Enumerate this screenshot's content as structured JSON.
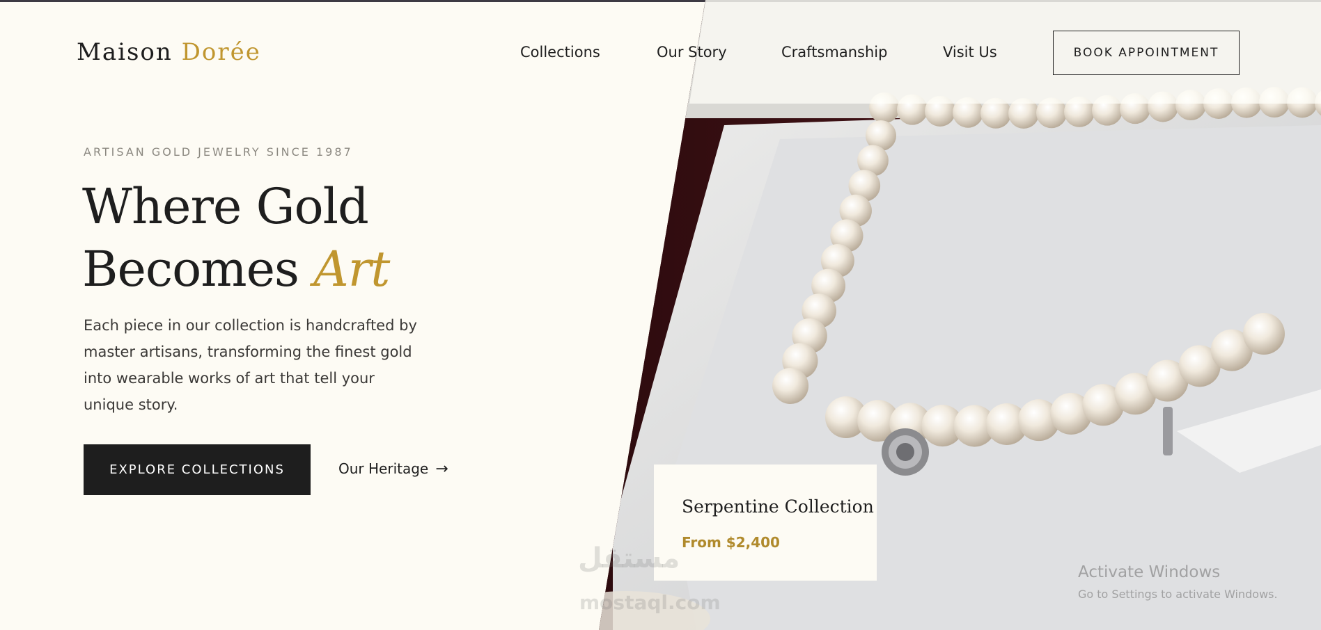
{
  "brand": {
    "name_primary": "Maison",
    "name_accent": "Dorée"
  },
  "nav": {
    "items": [
      {
        "label": "Collections"
      },
      {
        "label": "Our Story"
      },
      {
        "label": "Craftsmanship"
      },
      {
        "label": "Visit Us"
      }
    ],
    "cta_label": "BOOK APPOINTMENT"
  },
  "hero": {
    "eyebrow": "ARTISAN GOLD JEWELRY SINCE 1987",
    "headline_line1": "Where Gold",
    "headline_line2_plain": "Becomes",
    "headline_line2_accent": "Art",
    "description": "Each piece in our collection is handcrafted by master artisans, transforming the finest gold into wearable works of art that tell your unique story.",
    "primary_button": "EXPLORE COLLECTIONS",
    "secondary_link": "Our Heritage",
    "secondary_link_icon": "arrow-right-icon"
  },
  "feature_card": {
    "title": "Serpentine Collection",
    "price": "From $2,400"
  },
  "overlays": {
    "watermark_brand": "مستقل",
    "watermark_domain": "mostaql.com",
    "windows_activation_title": "Activate Windows",
    "windows_activation_sub": "Go to Settings to activate Windows."
  },
  "colors": {
    "background": "#fdfbf4",
    "text": "#1e1e1e",
    "gold_accent": "#c0962f",
    "button_dark": "#1e1e1e"
  }
}
